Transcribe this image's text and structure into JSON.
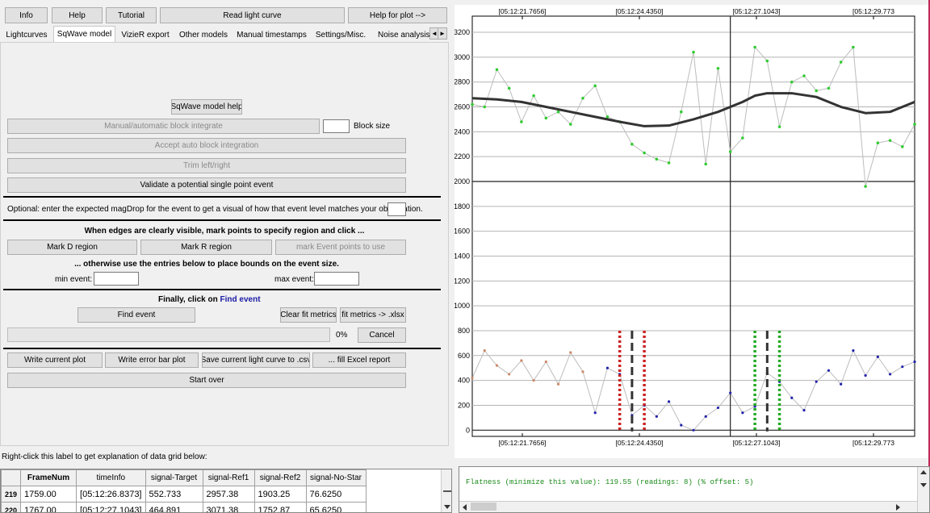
{
  "toolbar": {
    "info": "Info",
    "help": "Help",
    "tutorial": "Tutorial",
    "read_light_curve": "Read light curve",
    "help_for_plot": "Help for plot -->"
  },
  "tabs": [
    "Lightcurves",
    "SqWave model",
    "VizieR export",
    "Other models",
    "Manual timestamps",
    "Settings/Misc.",
    "Noise analysis/l"
  ],
  "tab_scroll": {
    "left": "◄",
    "right": "►"
  },
  "panel": {
    "sqwave_help": "SqWave model help",
    "block_integrate": "Manual/automatic block integrate",
    "block_size_label": "Block size",
    "accept_auto": "Accept auto block integration",
    "trim": "Trim left/right",
    "validate": "Validate a potential single point event",
    "optional_text": "Optional: enter the expected magDrop for the event to get a visual of how that event level matches your observation.",
    "edges_text": "When edges are clearly visible, mark points to specify region and click ...",
    "mark_d": "Mark D region",
    "mark_r": "Mark R region",
    "mark_event": "mark Event points to use",
    "otherwise_text": "... otherwise use the entries below to place bounds on the event size.",
    "min_event": "min event:",
    "max_event": "max event:",
    "finally_prefix": "Finally, click on",
    "finally_link": "Find event",
    "find_event": "Find event",
    "clear_fit": "Clear fit metrics",
    "fit_metrics": "fit metrics -> .xlsx",
    "progress": "0%",
    "cancel": "Cancel",
    "write_plot": "Write current plot",
    "write_error_bar": "Write error bar plot",
    "save_csv": "Save current light curve to .csv",
    "fill_excel": "... fill Excel report",
    "start_over": "Start over"
  },
  "grid_hint": "Right-click this label to get explanation of data grid below:",
  "data_grid": {
    "columns": [
      "FrameNum",
      "timeInfo",
      "signal-Target",
      "signal-Ref1",
      "signal-Ref2",
      "signal-No-Star"
    ],
    "rows": [
      {
        "index": "219",
        "cells": [
          "1759.00",
          "[05:12:26.8373]",
          "552.733",
          "2957.38",
          "1903.25",
          "76.6250"
        ]
      },
      {
        "index": "220",
        "cells": [
          "1767.00",
          "[05:12:27.1043]",
          "464.891",
          "3071.38",
          "1752.87",
          "65.6250"
        ]
      }
    ]
  },
  "flatness_text": "Flatness (minimize this value): 119.55 (readings: 8) (% offset: 5)",
  "chart_data": {
    "type": "line",
    "x_tick_labels": [
      "[05:12:21.7656]",
      "[05:12:24.4350]",
      "[05:12:27.1043]",
      "[05:12:29.773"
    ],
    "y_ticks": [
      0,
      200,
      400,
      600,
      800,
      1000,
      1200,
      1400,
      1600,
      1800,
      2000,
      2200,
      2400,
      2600,
      2800,
      3000,
      3200
    ],
    "ylim": [
      -50,
      3330
    ],
    "x_range": [
      0,
      36
    ],
    "vline_x": 21,
    "series": [
      {
        "color": "#33cc33",
        "x": [
          0,
          1,
          2,
          3,
          4,
          5,
          6,
          7,
          8,
          9,
          10,
          11,
          12,
          13,
          14,
          15,
          16,
          17,
          18,
          19,
          20,
          21,
          22,
          23,
          24,
          25,
          26,
          27,
          28,
          29,
          30,
          31,
          32,
          33,
          34,
          35,
          36
        ],
        "values": [
          2620,
          2600,
          2900,
          2750,
          2480,
          2690,
          2510,
          2560,
          2460,
          2670,
          2770,
          2520,
          2480,
          2300,
          2230,
          2180,
          2150,
          2560,
          3040,
          2140,
          2910,
          2240,
          2350,
          3080,
          2970,
          2440,
          2800,
          2850,
          2730,
          2750,
          2960,
          3080,
          1960,
          2310,
          2330,
          2280,
          2460
        ]
      },
      {
        "color": "#333333",
        "x": [
          0,
          2,
          4,
          6,
          8,
          10,
          12,
          14,
          16,
          18,
          20,
          22,
          23,
          24,
          26,
          28,
          30,
          32,
          34,
          36
        ],
        "values": [
          2670,
          2660,
          2640,
          2600,
          2560,
          2520,
          2480,
          2445,
          2450,
          2500,
          2560,
          2640,
          2690,
          2710,
          2710,
          2680,
          2600,
          2550,
          2560,
          2640
        ]
      },
      {
        "color": "#2222aa",
        "x": [
          0,
          1,
          2,
          3,
          4,
          5,
          6,
          7,
          8,
          9,
          10,
          11,
          12,
          13,
          14,
          15,
          16,
          17,
          18,
          19,
          20,
          21,
          22,
          23,
          24,
          25,
          26,
          27,
          28,
          29,
          30,
          31,
          32,
          33,
          34,
          35,
          36
        ],
        "values": [
          420,
          640,
          520,
          450,
          560,
          400,
          550,
          370,
          625,
          470,
          140,
          500,
          450,
          120,
          200,
          110,
          230,
          40,
          0,
          110,
          180,
          300,
          140,
          190,
          460,
          390,
          260,
          160,
          390,
          480,
          370,
          640,
          440,
          590,
          450,
          510,
          550
        ]
      }
    ],
    "markers": [
      {
        "x": 12,
        "color": "#cc2222"
      },
      {
        "x": 13,
        "color": "#333333"
      },
      {
        "x": 14,
        "color": "#cc2222"
      },
      {
        "x": 23,
        "color": "#22aa22"
      },
      {
        "x": 24,
        "color": "#333333"
      },
      {
        "x": 25,
        "color": "#22aa22"
      }
    ],
    "marker_range": [
      0,
      800
    ]
  }
}
